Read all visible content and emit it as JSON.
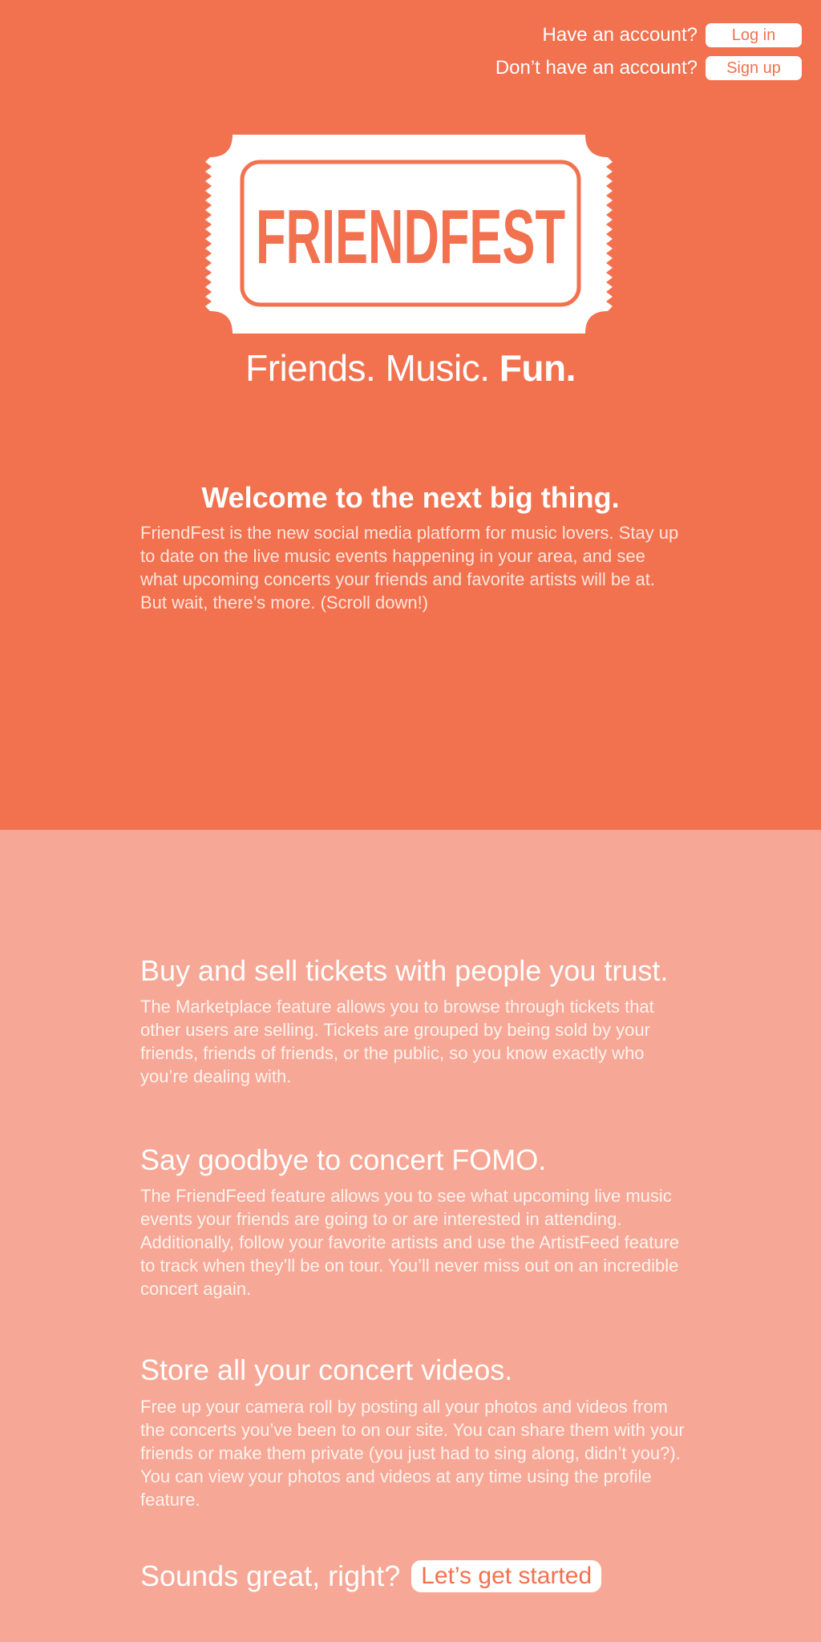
{
  "header": {
    "login_prompt": "Have an account?",
    "login_label": "Log in",
    "signup_prompt": "Don’t have an account?",
    "signup_label": "Sign up"
  },
  "logo": {
    "text": "FRIENDFEST"
  },
  "tagline": {
    "part1": "Friends. Music. ",
    "part2": "Fun."
  },
  "welcome": {
    "heading": "Welcome to the next big thing.",
    "body": "FriendFest is the new social media platform for music lovers. Stay up to date on the live music events happening in your area, and see what upcoming concerts your friends and favorite artists will be at. But wait, there’s more. (Scroll down!)"
  },
  "features": [
    {
      "heading": "Buy and sell tickets with people you trust.",
      "body": "The Marketplace feature allows you to browse through tickets that other users are selling. Tickets are grouped by being sold by your friends, friends of friends, or the public, so you know exactly who you’re dealing with."
    },
    {
      "heading": "Say goodbye to concert FOMO.",
      "body": "The FriendFeed feature allows you to see what upcoming live music events your friends are going to or are interested in attending. Additionally, follow your favorite artists and use the ArtistFeed feature to track when they’ll be on tour. You’ll never miss out on an incredible concert again."
    },
    {
      "heading": "Store all your concert videos.",
      "body": "Free up your camera roll by posting all your photos and videos from the concerts you’ve been to on our site. You can share them with your friends or make them private (you just had to sing along, didn’t you?). You can view your photos and videos at any time using the profile feature."
    }
  ],
  "cta": {
    "text": "Sounds great, right?",
    "button_label": "Let’s get started"
  },
  "colors": {
    "hero_bg": "#f2714f",
    "features_bg": "#f7a795",
    "accent": "#f2714f",
    "text": "#ffffff"
  }
}
